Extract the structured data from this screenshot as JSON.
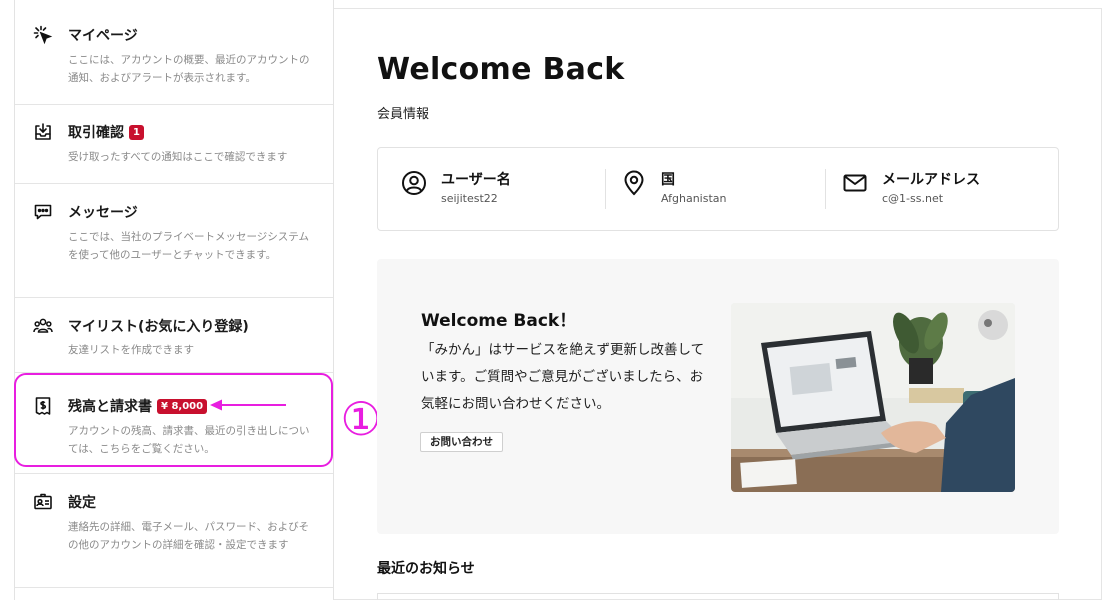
{
  "sidebar": {
    "items": [
      {
        "title": "マイページ",
        "icon": "pointer-click-icon",
        "desc": "ここには、アカウントの概要、最近のアカウントの通知、およびアラートが表示されます。"
      },
      {
        "title": "取引確認",
        "icon": "inbox-download-icon",
        "badge": "1",
        "desc": "受け取ったすべての通知はここで確認できます"
      },
      {
        "title": "メッセージ",
        "icon": "chat-bubble-icon",
        "desc": "ここでは、当社のプライベートメッセージシステムを使って他のユーザーとチャットできます。"
      },
      {
        "title": "マイリスト(お気に入り登録)",
        "icon": "users-group-icon",
        "desc": "友達リストを作成できます"
      },
      {
        "title": "残高と請求書",
        "icon": "receipt-icon",
        "badge": "¥ 8,000",
        "desc": "アカウントの残高、請求書、最近の引き出しについては、こちらをご覧ください。"
      },
      {
        "title": "設定",
        "icon": "id-card-icon",
        "desc": "連絡先の詳細、電子メール、パスワード、およびその他のアカウントの詳細を確認・設定できます"
      }
    ]
  },
  "annotation": {
    "number": "①",
    "color": "#e81ee0"
  },
  "main": {
    "title": "Welcome Back",
    "subtitle": "会員情報",
    "info": [
      {
        "label": "ユーザー名",
        "value": "seijitest22",
        "icon": "user-circle-icon"
      },
      {
        "label": "国",
        "value": "Afghanistan",
        "icon": "map-pin-icon"
      },
      {
        "label": "メールアドレス",
        "value": "c@1-ss.net",
        "icon": "mail-icon"
      }
    ],
    "welcome": {
      "title": "Welcome Back！",
      "body": "「みかん」はサービスを絶えず更新し改善しています。ご質問やご意見がございましたら、お気軽にお問い合わせください。",
      "button": "お問い合わせ"
    },
    "news_title": "最近のお知らせ"
  },
  "colors": {
    "badge": "#c8102e",
    "highlight": "#e81ee0"
  }
}
